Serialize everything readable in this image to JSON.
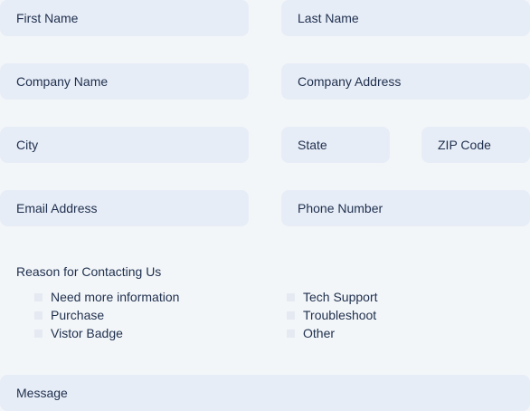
{
  "fields": {
    "first_name": "First Name",
    "last_name": "Last Name",
    "company_name": "Company Name",
    "company_address": "Company Address",
    "city": "City",
    "state": "State",
    "zip": "ZIP Code",
    "email": "Email Address",
    "phone": "Phone Number",
    "message": "Message"
  },
  "reason": {
    "title": "Reason for Contacting Us",
    "left_options": [
      "Need more information",
      "Purchase",
      "Vistor Badge"
    ],
    "right_options": [
      "Tech Support",
      "Troubleshoot",
      "Other"
    ]
  },
  "colors": {
    "background": "#f3f6f9",
    "field": "#e7edf7",
    "text": "#1e2f4d",
    "checkbox": "#e5eaf2"
  }
}
